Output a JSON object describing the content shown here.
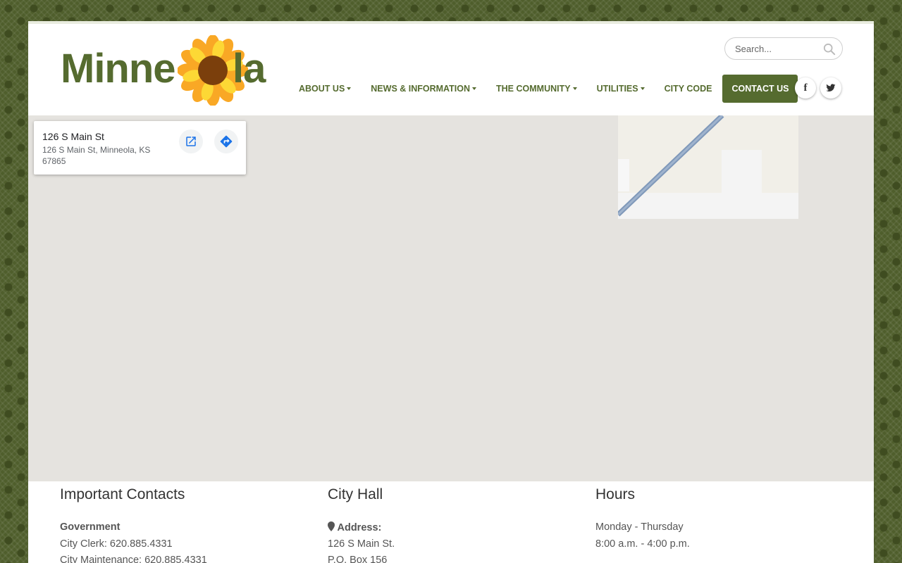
{
  "site": {
    "logo_text": "Minneola",
    "brand_color": "#556b2f",
    "page_bg_color": "#4f5e2c"
  },
  "search": {
    "placeholder": "Search...",
    "icon": "search-icon"
  },
  "nav": {
    "items": [
      {
        "label": "ABOUT US",
        "dropdown": true
      },
      {
        "label": "NEWS & INFORMATION",
        "dropdown": true
      },
      {
        "label": "THE COMMUNITY",
        "dropdown": true
      },
      {
        "label": "UTILITIES",
        "dropdown": true
      },
      {
        "label": "CITY CODE",
        "dropdown": false
      }
    ],
    "contact_label": "CONTACT US"
  },
  "social": {
    "facebook": "f",
    "twitter_icon": "twitter-bird-icon"
  },
  "map": {
    "place_name": "126 S Main St",
    "place_address": "126 S Main St, Minneola, KS 67865",
    "open_icon": "open-in-new-icon",
    "directions_icon": "directions-icon"
  },
  "footer": {
    "contacts": {
      "title": "Important Contacts",
      "group": "Government",
      "lines": [
        "City Clerk: 620.885.4331",
        "City Maintenance: 620.885.4331"
      ]
    },
    "city_hall": {
      "title": "City Hall",
      "address_label": "Address:",
      "lines": [
        "126 S Main St.",
        "P.O. Box 156"
      ]
    },
    "hours": {
      "title": "Hours",
      "lines": [
        "Monday - Thursday",
        "8:00 a.m. - 4:00 p.m."
      ]
    }
  }
}
